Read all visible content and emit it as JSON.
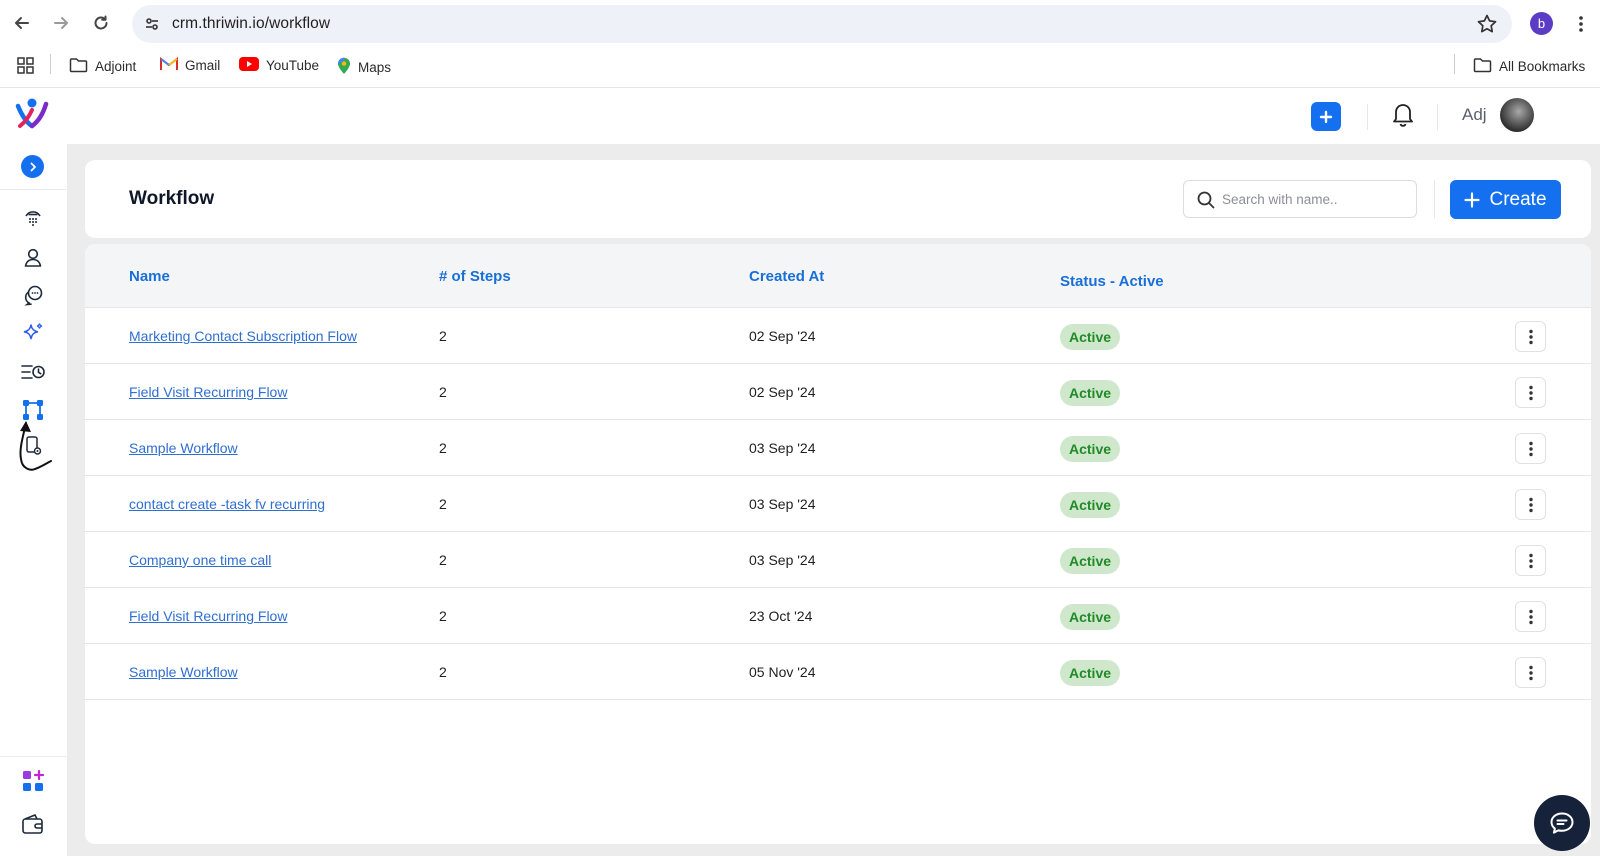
{
  "browser": {
    "url": "crm.thriwin.io/workflow",
    "profile_initial": "b",
    "bookmarks": [
      {
        "label": "Adjoint",
        "icon": "folder-icon"
      },
      {
        "label": "Gmail",
        "icon": "gmail-icon"
      },
      {
        "label": "YouTube",
        "icon": "youtube-icon"
      },
      {
        "label": "Maps",
        "icon": "maps-icon"
      }
    ],
    "all_bookmarks": "All Bookmarks"
  },
  "header": {
    "user_name": "Adj"
  },
  "sidebar": {
    "items": [
      {
        "name": "calls-icon"
      },
      {
        "name": "contacts-icon"
      },
      {
        "name": "conversations-icon"
      },
      {
        "name": "ai-sparkle-icon"
      },
      {
        "name": "activity-history-icon"
      },
      {
        "name": "workflow-icon"
      },
      {
        "name": "settings-device-icon"
      }
    ],
    "bottom_items": [
      {
        "name": "add-app-icon"
      },
      {
        "name": "wallet-icon"
      }
    ]
  },
  "page": {
    "title": "Workflow",
    "search_placeholder": "Search with name..",
    "create_label": "Create"
  },
  "table": {
    "columns": [
      "Name",
      "# of Steps",
      "Created At",
      "Status - Active"
    ],
    "rows": [
      {
        "name": "Marketing Contact Subscription Flow",
        "steps": "2",
        "created": "02 Sep '24",
        "status": "Active"
      },
      {
        "name": "Field Visit Recurring Flow",
        "steps": "2",
        "created": "02 Sep '24",
        "status": "Active"
      },
      {
        "name": "Sample Workflow",
        "steps": "2",
        "created": "03 Sep '24",
        "status": "Active"
      },
      {
        "name": "contact create -task fv recurring",
        "steps": "2",
        "created": "03 Sep '24",
        "status": "Active"
      },
      {
        "name": "Company one time call",
        "steps": "2",
        "created": "03 Sep '24",
        "status": "Active"
      },
      {
        "name": "Field Visit Recurring Flow",
        "steps": "2",
        "created": "23 Oct '24",
        "status": "Active"
      },
      {
        "name": "Sample Workflow",
        "steps": "2",
        "created": "05 Nov '24",
        "status": "Active"
      }
    ]
  },
  "colors": {
    "accent": "#1570ef",
    "link": "#2f6fd0",
    "active_badge_bg": "#cfe8cc",
    "active_badge_text": "#21892a"
  }
}
